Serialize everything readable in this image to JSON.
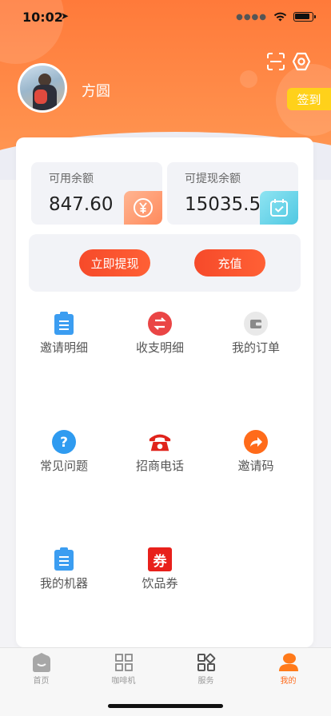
{
  "status_bar": {
    "time": "10:02",
    "location_glyph": "➤"
  },
  "profile": {
    "name": "方圆",
    "checkin_label": "签到"
  },
  "balances": [
    {
      "label": "可用余额",
      "value": "847.60",
      "icon": "yen-icon",
      "color": "#ff9a6e"
    },
    {
      "label": "可提现余额",
      "value": "15035.54",
      "icon": "calendar-icon",
      "color": "#5ad0e6"
    }
  ],
  "actions": {
    "withdraw_label": "立即提现",
    "recharge_label": "充值",
    "accent": "#f64a2a"
  },
  "menu": [
    {
      "label": "邀请明细",
      "icon": "clipboard-icon"
    },
    {
      "label": "收支明细",
      "icon": "exchange-icon"
    },
    {
      "label": "我的订单",
      "icon": "wallet-icon"
    },
    {
      "label": "常见问题",
      "icon": "question-icon"
    },
    {
      "label": "招商电话",
      "icon": "phone-icon"
    },
    {
      "label": "邀请码",
      "icon": "share-icon"
    },
    {
      "label": "我的机器",
      "icon": "clipboard-icon"
    },
    {
      "label": "饮品券",
      "icon": "coupon-icon",
      "icon_text": "券"
    }
  ],
  "tabs": [
    {
      "label": "首页",
      "icon": "home-icon",
      "active": false
    },
    {
      "label": "咖啡机",
      "icon": "grid-icon",
      "active": false
    },
    {
      "label": "服务",
      "icon": "services-icon",
      "active": false
    },
    {
      "label": "我的",
      "icon": "profile-icon",
      "active": true
    }
  ]
}
